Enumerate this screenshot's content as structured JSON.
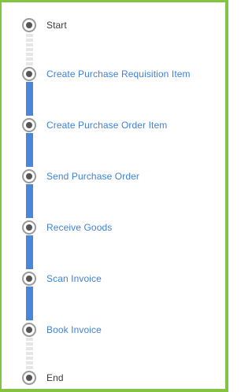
{
  "flow": {
    "steps": [
      {
        "label": "Start",
        "kind": "endpoint"
      },
      {
        "label": "Create Purchase Requisition Item",
        "kind": "activity"
      },
      {
        "label": "Create Purchase Order Item",
        "kind": "activity"
      },
      {
        "label": "Send Purchase Order",
        "kind": "activity"
      },
      {
        "label": "Receive Goods",
        "kind": "activity"
      },
      {
        "label": "Scan Invoice",
        "kind": "activity"
      },
      {
        "label": "Book Invoice",
        "kind": "activity"
      },
      {
        "label": "End",
        "kind": "endpoint"
      }
    ],
    "connectors": [
      "dashed",
      "solid",
      "solid",
      "solid",
      "solid",
      "solid",
      "dashed"
    ]
  },
  "colors": {
    "frame_border": "#83c341",
    "activity_link": "#3f82d8",
    "endpoint_text": "#3a3a3a",
    "solid_connector": "#4a86d9",
    "dashed_connector": "#e6e6e6"
  }
}
